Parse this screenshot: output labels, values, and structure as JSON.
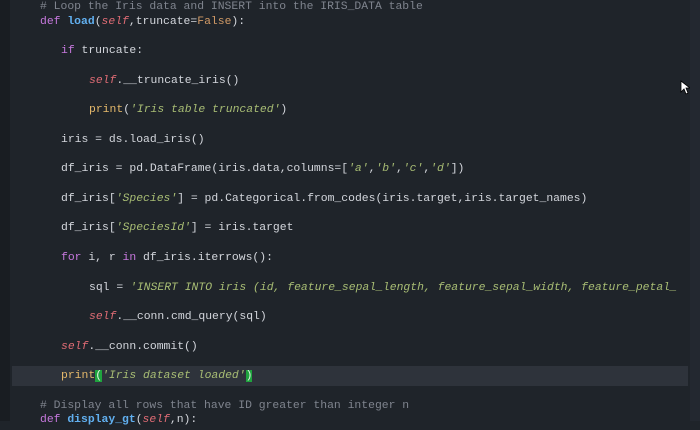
{
  "editor": {
    "lines": [
      {
        "indent": 0,
        "tokens": [
          [
            "cm",
            "# Loop the Iris data and INSERT into the IRIS_DATA table"
          ]
        ]
      },
      {
        "indent": 0,
        "tokens": [
          [
            "kw",
            "def "
          ],
          [
            "fn",
            "load"
          ],
          [
            "pl",
            "("
          ],
          [
            "sf",
            "self"
          ],
          [
            "pl",
            ",truncate="
          ],
          [
            "bo",
            "False"
          ],
          [
            "pl",
            "):"
          ]
        ]
      },
      {
        "indent": 1,
        "tokens": [
          [
            "kw",
            "if "
          ],
          [
            "pl",
            "truncate:"
          ]
        ]
      },
      {
        "indent": 2,
        "tokens": [
          [
            "sf",
            "self"
          ],
          [
            "pl",
            "."
          ],
          [
            "pl",
            "__truncate_iris()"
          ]
        ]
      },
      {
        "indent": 2,
        "tokens": [
          [
            "pr",
            "print"
          ],
          [
            "pl",
            "("
          ],
          [
            "st",
            "'Iris table truncated'"
          ],
          [
            "pl",
            ")"
          ]
        ]
      },
      {
        "indent": 1,
        "tokens": [
          [
            "pl",
            "iris = ds.load_iris()"
          ]
        ]
      },
      {
        "indent": 1,
        "tokens": [
          [
            "pl",
            "df_iris = pd.DataFrame(iris.data,columns=["
          ],
          [
            "st",
            "'a'"
          ],
          [
            "pl",
            ","
          ],
          [
            "st",
            "'b'"
          ],
          [
            "pl",
            ","
          ],
          [
            "st",
            "'c'"
          ],
          [
            "pl",
            ","
          ],
          [
            "st",
            "'d'"
          ],
          [
            "pl",
            "])"
          ]
        ]
      },
      {
        "indent": 1,
        "tokens": [
          [
            "pl",
            "df_iris["
          ],
          [
            "st",
            "'Species'"
          ],
          [
            "pl",
            "] = pd.Categorical.from_codes(iris.target,iris.target_names)"
          ]
        ]
      },
      {
        "indent": 1,
        "tokens": [
          [
            "pl",
            "df_iris["
          ],
          [
            "st",
            "'SpeciesId'"
          ],
          [
            "pl",
            "] = iris.target"
          ]
        ]
      },
      {
        "indent": 1,
        "tokens": [
          [
            "kw",
            "for "
          ],
          [
            "pl",
            "i, r "
          ],
          [
            "kw",
            "in "
          ],
          [
            "pl",
            "df_iris.iterrows():"
          ]
        ]
      },
      {
        "indent": 2,
        "tokens": [
          [
            "pl",
            "sql = "
          ],
          [
            "st",
            "'INSERT INTO iris (id, feature_sepal_length, feature_sepal_width, feature_petal_"
          ]
        ]
      },
      {
        "indent": 2,
        "tokens": [
          [
            "sf",
            "self"
          ],
          [
            "pl",
            "."
          ],
          [
            "pl",
            "__conn.cmd_query(sql)"
          ]
        ]
      },
      {
        "indent": 1,
        "tokens": [
          [
            "sf",
            "self"
          ],
          [
            "pl",
            "."
          ],
          [
            "pl",
            "__conn.commit()"
          ]
        ]
      },
      {
        "indent": 1,
        "active": true,
        "tokens": [
          [
            "pr",
            "print"
          ],
          [
            "br",
            "("
          ],
          [
            "st",
            "'Iris dataset loaded'"
          ],
          [
            "br",
            ")"
          ]
        ]
      },
      {
        "indent": 0,
        "tokens": [
          [
            "cm",
            "# Display all rows that have ID greater than integer n"
          ]
        ]
      },
      {
        "indent": 0,
        "tokens": [
          [
            "kw",
            "def "
          ],
          [
            "fn",
            "display_gt"
          ],
          [
            "pl",
            "("
          ],
          [
            "sf",
            "self"
          ],
          [
            "pl",
            ",n):"
          ]
        ]
      }
    ]
  }
}
